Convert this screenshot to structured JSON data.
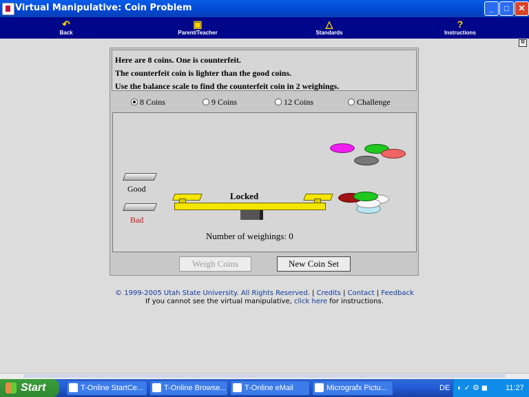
{
  "window": {
    "title": "Virtual Manipulative: Coin Problem"
  },
  "toolbar": {
    "back": "Back",
    "parent_teacher": "Parent/Teacher",
    "standards": "Standards",
    "instructions": "Instructions",
    "instructions_glyph": "?"
  },
  "intro": {
    "line1": "Here are 8 coins. One is counterfeit.",
    "line2": "The counterfeit coin is lighter than the good coins.",
    "line3": "Use the balance scale to find the counterfeit coin in 2 weighings."
  },
  "options": [
    {
      "label": "8 Coins",
      "selected": true
    },
    {
      "label": "9 Coins",
      "selected": false
    },
    {
      "label": "12 Coins",
      "selected": false
    },
    {
      "label": "Challenge",
      "selected": false
    }
  ],
  "stage": {
    "good_label": "Good",
    "bad_label": "Bad",
    "scale_status": "Locked",
    "weighings_text": "Number of weighings: 0",
    "coin_colors": {
      "magenta": "#f01ef0",
      "green": "#1ec81e",
      "salmon": "#f06464",
      "gray": "#787878",
      "darkred": "#a01414",
      "white": "#f8f8f8",
      "lightblue": "#b9e6f0"
    }
  },
  "buttons": {
    "weigh": "Weigh Coins",
    "new_set": "New Coin Set"
  },
  "footer": {
    "copyright": "© 1999-2005 Utah State University. All Rights Reserved.",
    "sep": "|",
    "credits": "Credits",
    "contact": "Contact",
    "feedback": "Feedback",
    "help_prefix": "If you cannot see the virtual manipulative,",
    "help_link": "click here",
    "help_suffix": "for instructions."
  },
  "taskbar": {
    "start": "Start",
    "tasks": [
      "T-Online StartCe...",
      "T-Online Browse...",
      "T-Online eMail",
      "Micrografx Pictu..."
    ],
    "lang": "DE",
    "clock": "11:27"
  }
}
